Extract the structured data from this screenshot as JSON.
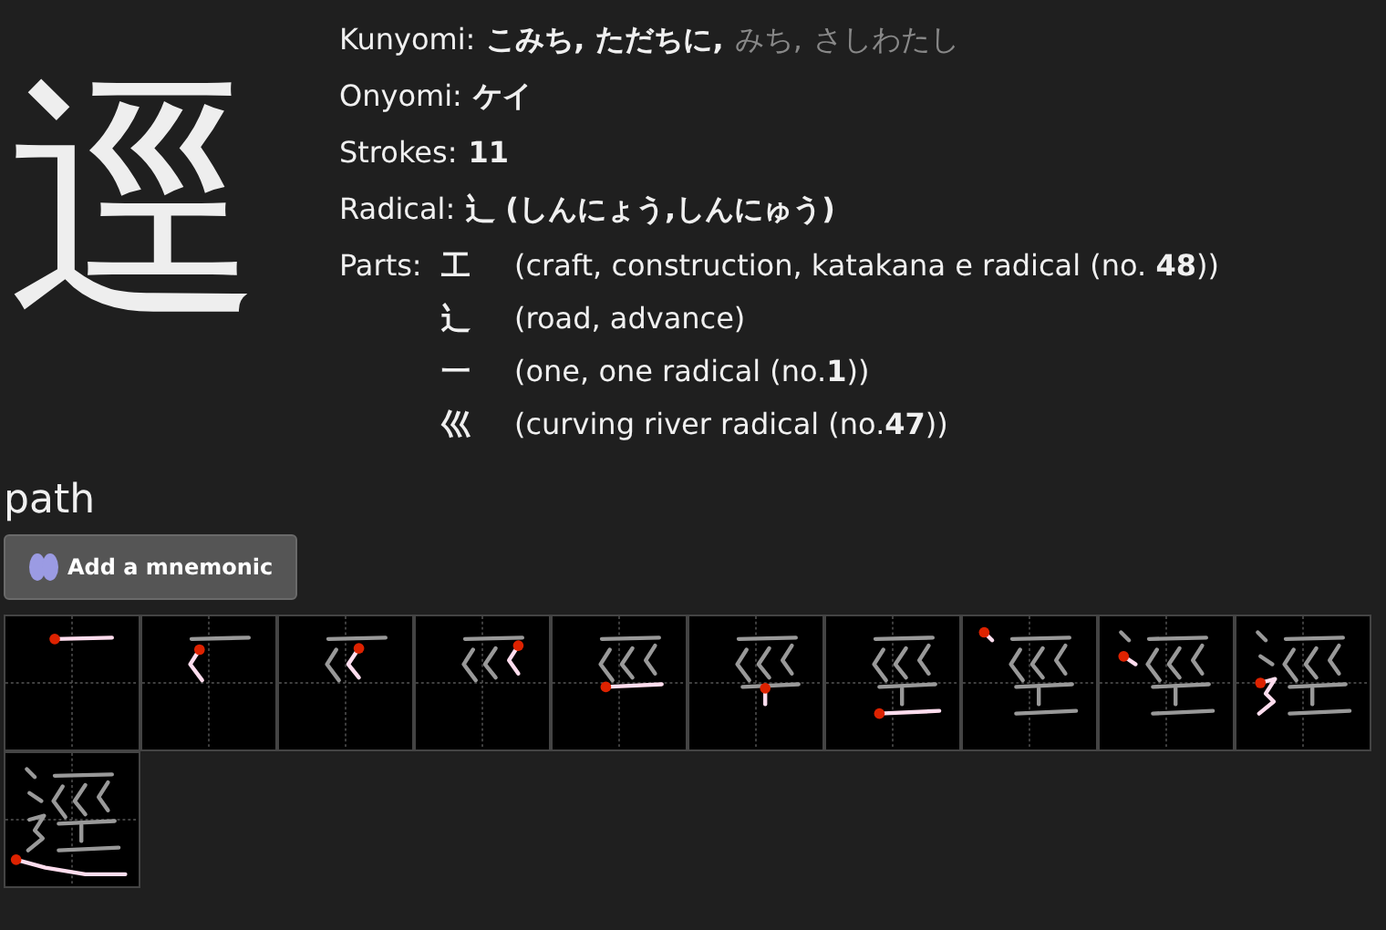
{
  "kanji": "逕",
  "kunyomi": {
    "label": "Kunyomi:",
    "readings": [
      {
        "text": "こみち,",
        "muted": false
      },
      {
        "text": "ただちに,",
        "muted": false
      },
      {
        "text": "みち,",
        "muted": true
      },
      {
        "text": "さしわたし",
        "muted": true
      }
    ]
  },
  "onyomi": {
    "label": "Onyomi:",
    "value": "ケイ"
  },
  "strokes": {
    "label": "Strokes:",
    "value": "11"
  },
  "radical": {
    "label": "Radical:",
    "value": "⻌ (しんにょう,しんにゅう)"
  },
  "parts": {
    "label": "Parts:",
    "items": [
      {
        "char": "工",
        "description": "(craft, construction, katakana e radical (no. **48**))"
      },
      {
        "char": "⻌",
        "description": "(road, advance)"
      },
      {
        "char": "一",
        "description": "(one, one radical (no.**1**))"
      },
      {
        "char": "巛",
        "description": "(curving river radical (no.**47**))"
      }
    ]
  },
  "heading": "path",
  "mnemonic_button": "Add a mnemonic",
  "stroke_order": [
    {
      "kind": "stroke"
    },
    {
      "kind": "stroke"
    },
    {
      "kind": "stroke"
    },
    {
      "kind": "stroke"
    },
    {
      "kind": "stroke"
    },
    {
      "kind": "stroke"
    },
    {
      "kind": "stroke"
    },
    {
      "kind": "stroke"
    },
    {
      "kind": "stroke"
    },
    {
      "kind": "stroke"
    },
    {
      "kind": "stroke"
    }
  ]
}
